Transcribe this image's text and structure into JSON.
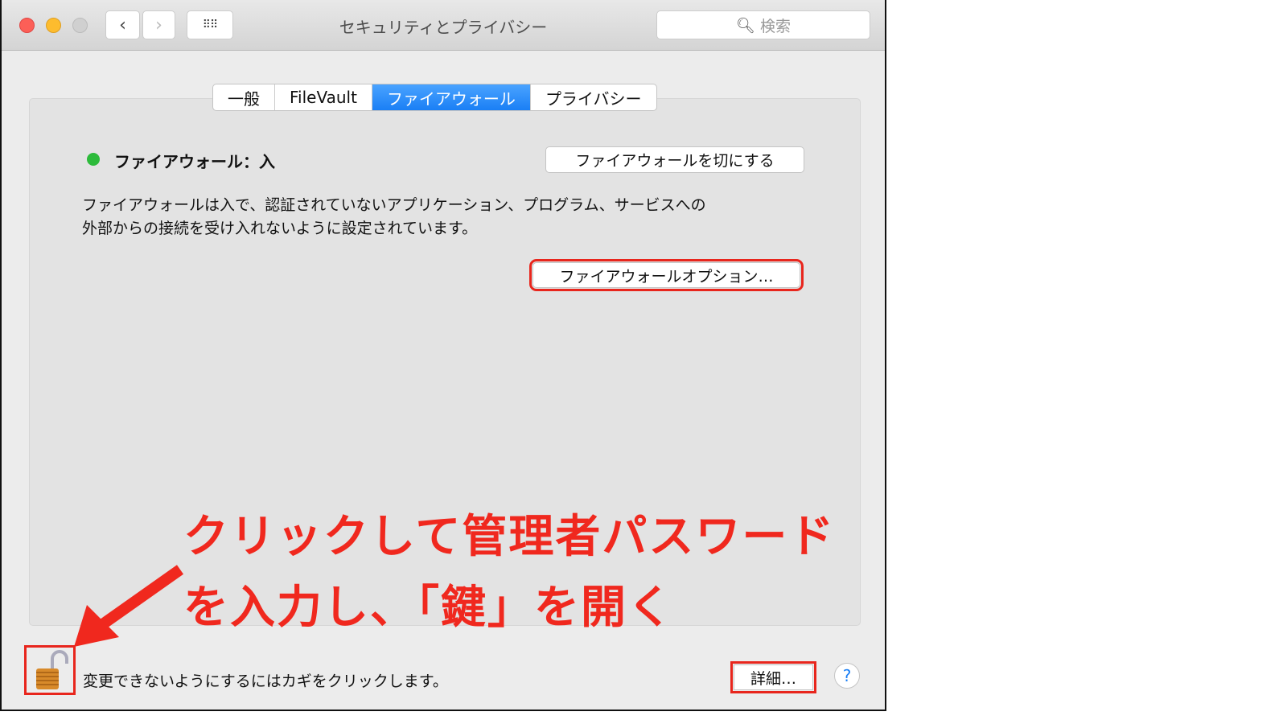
{
  "window": {
    "title": "セキュリティとプライバシー",
    "search_placeholder": "検索"
  },
  "tabs": [
    {
      "label": "一般"
    },
    {
      "label": "FileVault"
    },
    {
      "label": "ファイアウォール",
      "active": true
    },
    {
      "label": "プライバシー"
    }
  ],
  "firewall": {
    "status": "ファイアウォール：入",
    "status_color": "#2dbb3b",
    "toggle_button": "ファイアウォールを切にする",
    "description_line1": "ファイアウォールは入で、認証されていないアプリケーション、プログラム、サービスへの",
    "description_line2": "外部からの接続を受け入れないように設定されています。",
    "options_button": "ファイアウォールオプション…"
  },
  "footer": {
    "lock_text": "変更できないようにするにはカギをクリックします。",
    "advanced_button": "詳細…",
    "help": "?"
  },
  "annotation": {
    "line1": "クリックして管理者パスワード",
    "line2": "を入力し、「鍵」を開く",
    "color": "#f0281e"
  }
}
